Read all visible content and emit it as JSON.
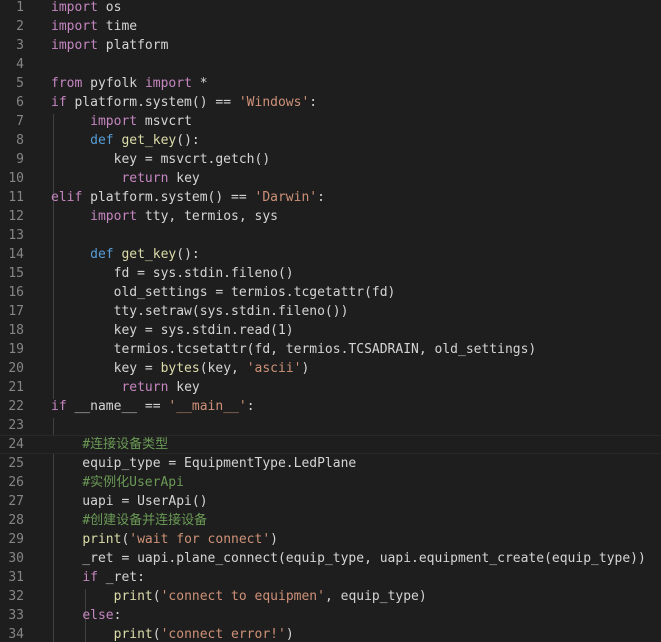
{
  "theme": {
    "background": "#1e1e1e",
    "foreground": "#d4d4d4",
    "line_number": "#858585",
    "keyword": "#569cd6",
    "control": "#c586c0",
    "string": "#ce9178",
    "comment": "#6a9955",
    "function": "#dcdcaa"
  },
  "editor": {
    "current_line": 24,
    "lines": [
      {
        "n": "1",
        "tokens": [
          [
            "ctrl",
            "import"
          ],
          [
            "plain",
            " os"
          ]
        ]
      },
      {
        "n": "2",
        "tokens": [
          [
            "ctrl",
            "import"
          ],
          [
            "plain",
            " time"
          ]
        ]
      },
      {
        "n": "3",
        "tokens": [
          [
            "ctrl",
            "import"
          ],
          [
            "plain",
            " platform"
          ]
        ]
      },
      {
        "n": "4",
        "tokens": []
      },
      {
        "n": "5",
        "tokens": [
          [
            "ctrl",
            "from"
          ],
          [
            "plain",
            " pyfolk "
          ],
          [
            "ctrl",
            "import"
          ],
          [
            "plain",
            " *"
          ]
        ]
      },
      {
        "n": "6",
        "tokens": [
          [
            "ctrl",
            "if"
          ],
          [
            "plain",
            " platform.system() == "
          ],
          [
            "str",
            "'Windows'"
          ],
          [
            "plain",
            ":"
          ]
        ]
      },
      {
        "n": "7",
        "tokens": [
          [
            "plain",
            "     "
          ],
          [
            "ctrl",
            "import"
          ],
          [
            "plain",
            " msvcrt"
          ]
        ]
      },
      {
        "n": "8",
        "tokens": [
          [
            "plain",
            "     "
          ],
          [
            "kw",
            "def"
          ],
          [
            "plain",
            " "
          ],
          [
            "fn",
            "get_key"
          ],
          [
            "plain",
            "():"
          ]
        ]
      },
      {
        "n": "9",
        "tokens": [
          [
            "plain",
            "        key = msvcrt.getch()"
          ]
        ]
      },
      {
        "n": "10",
        "tokens": [
          [
            "plain",
            "         "
          ],
          [
            "ctrl",
            "return"
          ],
          [
            "plain",
            " key"
          ]
        ]
      },
      {
        "n": "11",
        "tokens": [
          [
            "ctrl",
            "elif"
          ],
          [
            "plain",
            " platform.system() == "
          ],
          [
            "str",
            "'Darwin'"
          ],
          [
            "plain",
            ":"
          ]
        ]
      },
      {
        "n": "12",
        "tokens": [
          [
            "plain",
            "     "
          ],
          [
            "ctrl",
            "import"
          ],
          [
            "plain",
            " tty, termios, sys"
          ]
        ]
      },
      {
        "n": "13",
        "tokens": []
      },
      {
        "n": "14",
        "tokens": [
          [
            "plain",
            "     "
          ],
          [
            "kw",
            "def"
          ],
          [
            "plain",
            " "
          ],
          [
            "fn",
            "get_key"
          ],
          [
            "plain",
            "():"
          ]
        ]
      },
      {
        "n": "15",
        "tokens": [
          [
            "plain",
            "        fd = sys.stdin.fileno()"
          ]
        ]
      },
      {
        "n": "16",
        "tokens": [
          [
            "plain",
            "        old_settings = termios.tcgetattr(fd)"
          ]
        ]
      },
      {
        "n": "17",
        "tokens": [
          [
            "plain",
            "        tty.setraw(sys.stdin.fileno())"
          ]
        ]
      },
      {
        "n": "18",
        "tokens": [
          [
            "plain",
            "        key = sys.stdin.read(1)"
          ]
        ]
      },
      {
        "n": "19",
        "tokens": [
          [
            "plain",
            "        termios.tcsetattr(fd, termios.TCSADRAIN, old_settings)"
          ]
        ]
      },
      {
        "n": "20",
        "tokens": [
          [
            "plain",
            "        key = "
          ],
          [
            "fn",
            "bytes"
          ],
          [
            "plain",
            "(key, "
          ],
          [
            "str",
            "'ascii'"
          ],
          [
            "plain",
            ")"
          ]
        ]
      },
      {
        "n": "21",
        "tokens": [
          [
            "plain",
            "         "
          ],
          [
            "ctrl",
            "return"
          ],
          [
            "plain",
            " key"
          ]
        ]
      },
      {
        "n": "22",
        "tokens": [
          [
            "ctrl",
            "if"
          ],
          [
            "plain",
            " __name__ == "
          ],
          [
            "str",
            "'__main__'"
          ],
          [
            "plain",
            ":"
          ]
        ]
      },
      {
        "n": "23",
        "tokens": []
      },
      {
        "n": "24",
        "tokens": [
          [
            "plain",
            "    "
          ],
          [
            "cm",
            "#连接设备类型"
          ]
        ]
      },
      {
        "n": "25",
        "tokens": [
          [
            "plain",
            "    equip_type = EquipmentType.LedPlane"
          ]
        ]
      },
      {
        "n": "26",
        "tokens": [
          [
            "plain",
            "    "
          ],
          [
            "cm",
            "#实例化UserApi"
          ]
        ]
      },
      {
        "n": "27",
        "tokens": [
          [
            "plain",
            "    uapi = UserApi()"
          ]
        ]
      },
      {
        "n": "28",
        "tokens": [
          [
            "plain",
            "    "
          ],
          [
            "cm",
            "#创建设备并连接设备"
          ]
        ]
      },
      {
        "n": "29",
        "tokens": [
          [
            "plain",
            "    "
          ],
          [
            "fn",
            "print"
          ],
          [
            "plain",
            "("
          ],
          [
            "str",
            "'wait for connect'"
          ],
          [
            "plain",
            ")"
          ]
        ]
      },
      {
        "n": "30",
        "tokens": [
          [
            "plain",
            "    _ret = uapi.plane_connect(equip_type, uapi.equipment_create(equip_type))"
          ]
        ]
      },
      {
        "n": "31",
        "tokens": [
          [
            "plain",
            "    "
          ],
          [
            "ctrl",
            "if"
          ],
          [
            "plain",
            " _ret:"
          ]
        ]
      },
      {
        "n": "32",
        "tokens": [
          [
            "plain",
            "        "
          ],
          [
            "fn",
            "print"
          ],
          [
            "plain",
            "("
          ],
          [
            "str",
            "'connect to equipmen'"
          ],
          [
            "plain",
            ", equip_type)"
          ]
        ]
      },
      {
        "n": "33",
        "tokens": [
          [
            "plain",
            "    "
          ],
          [
            "ctrl",
            "else"
          ],
          [
            "plain",
            ":"
          ]
        ]
      },
      {
        "n": "34",
        "tokens": [
          [
            "plain",
            "        "
          ],
          [
            "fn",
            "print"
          ],
          [
            "plain",
            "("
          ],
          [
            "str",
            "'connect error!'"
          ],
          [
            "plain",
            ")"
          ]
        ]
      }
    ]
  }
}
